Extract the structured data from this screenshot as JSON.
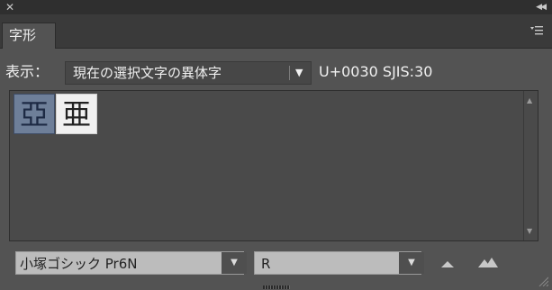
{
  "panel": {
    "tab_label": "字形"
  },
  "show_row": {
    "label": "表示：",
    "selected_option": "現在の選択文字の異体字",
    "code_info": "U+0030 SJIS:30"
  },
  "glyphs": [
    {
      "char": "亞",
      "selected": true
    },
    {
      "char": "亜",
      "selected": false
    }
  ],
  "bottom": {
    "font_family": "小塚ゴシック Pr6N",
    "font_style": "R"
  },
  "icons": {
    "close": "close-icon",
    "collapse": "collapse-icon",
    "menu": "panel-menu-icon",
    "zoom_out": "zoom-out-icon",
    "zoom_in": "zoom-in-icon"
  },
  "colors": {
    "panel_bg": "#535353",
    "selected_glyph_bg": "#6e7f99",
    "normal_glyph_bg": "#f1f1f1"
  }
}
